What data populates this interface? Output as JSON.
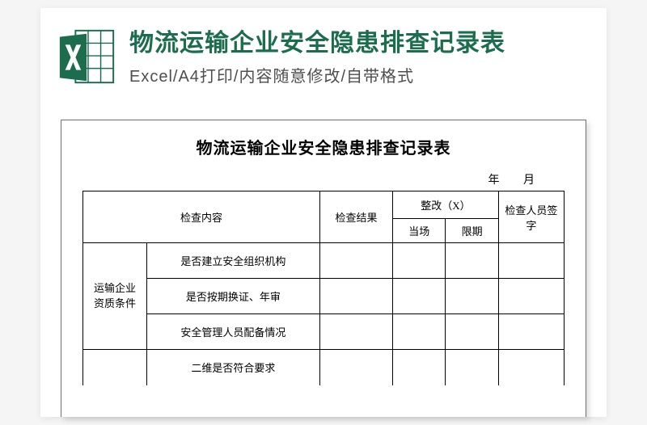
{
  "header": {
    "title": "物流运输企业安全隐患排查记录表",
    "subtitle": "Excel/A4打印/内容随意修改/自带格式",
    "icon_name": "excel-file-icon"
  },
  "document": {
    "title": "物流运输企业安全隐患排查记录表",
    "date_labels": {
      "year": "年",
      "month": "月"
    },
    "headers": {
      "content": "检查内容",
      "result": "检查结果",
      "fix_group": "整改（X）",
      "fix_now": "当场",
      "fix_deadline": "限期",
      "sign": "检查人员签字"
    },
    "sections": [
      {
        "category": "运输企业资质条件",
        "items": [
          "是否建立安全组织机构",
          "是否按期换证、年审",
          "安全管理人员配备情况"
        ]
      },
      {
        "category": "",
        "items": [
          "二维是否符合要求"
        ]
      }
    ]
  }
}
